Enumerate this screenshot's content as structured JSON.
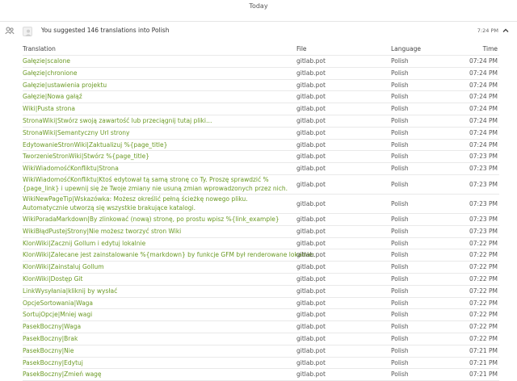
{
  "day_label": "Today",
  "activity": {
    "icon": "people-icon",
    "text": "You suggested 146 translations into Polish",
    "time": "7:24 PM",
    "collapse_icon": "chevron-up-icon"
  },
  "table": {
    "headers": {
      "translation": "Translation",
      "file": "File",
      "language": "Language",
      "time": "Time"
    },
    "rows": [
      {
        "translation": "Gałęzie|scalone",
        "file": "gitlab.pot",
        "language": "Polish",
        "time": "07:24 PM"
      },
      {
        "translation": "Gałęzie|chronione",
        "file": "gitlab.pot",
        "language": "Polish",
        "time": "07:24 PM"
      },
      {
        "translation": "Gałęzie|ustawienia projektu",
        "file": "gitlab.pot",
        "language": "Polish",
        "time": "07:24 PM"
      },
      {
        "translation": "Gałęzie|Nowa gałąź",
        "file": "gitlab.pot",
        "language": "Polish",
        "time": "07:24 PM"
      },
      {
        "translation": "Wiki|Pusta strona",
        "file": "gitlab.pot",
        "language": "Polish",
        "time": "07:24 PM"
      },
      {
        "translation": "StronaWiki|Stwórz swoją zawartość lub przeciągnij tutaj pliki…",
        "file": "gitlab.pot",
        "language": "Polish",
        "time": "07:24 PM"
      },
      {
        "translation": "StronaWiki|Semantyczny Url strony",
        "file": "gitlab.pot",
        "language": "Polish",
        "time": "07:24 PM"
      },
      {
        "translation": "EdytowanieStronWiki|Zaktualizuj %{page_title}",
        "file": "gitlab.pot",
        "language": "Polish",
        "time": "07:24 PM"
      },
      {
        "translation": "TworzenieStronWiki|Stwórz %{page_title}",
        "file": "gitlab.pot",
        "language": "Polish",
        "time": "07:23 PM"
      },
      {
        "translation": "WikiWiadomośćKonfliktu|Strona",
        "file": "gitlab.pot",
        "language": "Polish",
        "time": "07:23 PM"
      },
      {
        "translation": "WikiWiadomośćKonfliktu|Ktoś edytował tą samą stronę co Ty. Proszę sprawdzić %{page_link} i upewnij się że Twoje zmiany nie usuną zmian wprowadzonych przez nich.",
        "file": "gitlab.pot",
        "language": "Polish",
        "time": "07:23 PM",
        "tall": true
      },
      {
        "translation": "WikiNewPageTip|Wskazówka: Możesz określić pełną ścieżkę nowego pliku. Automatycznie utworzą się wszystkie brakujące katalogi.",
        "file": "gitlab.pot",
        "language": "Polish",
        "time": "07:23 PM",
        "tall": true
      },
      {
        "translation": "WikiPoradaMarkdown|By zlinkować (nową) stronę, po prostu wpisz %{link_example}",
        "file": "gitlab.pot",
        "language": "Polish",
        "time": "07:23 PM"
      },
      {
        "translation": "WikiBłądPustejStrony|Nie możesz tworzyć stron Wiki",
        "file": "gitlab.pot",
        "language": "Polish",
        "time": "07:23 PM"
      },
      {
        "translation": "KlonWiki|Zacznij Gollum i edytuj lokalnie",
        "file": "gitlab.pot",
        "language": "Polish",
        "time": "07:22 PM"
      },
      {
        "translation": "KlonWiki|Zalecane jest zainstalowanie %{markdown} by funkcje GFM był renderowane lokalnie:",
        "file": "gitlab.pot",
        "language": "Polish",
        "time": "07:22 PM"
      },
      {
        "translation": "KlonWiki|Zainstaluj Gollum",
        "file": "gitlab.pot",
        "language": "Polish",
        "time": "07:22 PM"
      },
      {
        "translation": "KlonWiki|Dostęp Git",
        "file": "gitlab.pot",
        "language": "Polish",
        "time": "07:22 PM"
      },
      {
        "translation": "LinkWysyłania|kliknij by wysłać",
        "file": "gitlab.pot",
        "language": "Polish",
        "time": "07:22 PM"
      },
      {
        "translation": "OpcjeSortowania|Waga",
        "file": "gitlab.pot",
        "language": "Polish",
        "time": "07:22 PM"
      },
      {
        "translation": "SortujOpcje|Mniej wagi",
        "file": "gitlab.pot",
        "language": "Polish",
        "time": "07:22 PM"
      },
      {
        "translation": "PasekBoczny|Waga",
        "file": "gitlab.pot",
        "language": "Polish",
        "time": "07:22 PM"
      },
      {
        "translation": "PasekBoczny|Brak",
        "file": "gitlab.pot",
        "language": "Polish",
        "time": "07:22 PM"
      },
      {
        "translation": "PasekBoczny|Nie",
        "file": "gitlab.pot",
        "language": "Polish",
        "time": "07:21 PM"
      },
      {
        "translation": "PasekBoczny|Edytuj",
        "file": "gitlab.pot",
        "language": "Polish",
        "time": "07:21 PM"
      },
      {
        "translation": "PasekBoczny|Zmień wagę",
        "file": "gitlab.pot",
        "language": "Polish",
        "time": "07:21 PM"
      }
    ]
  }
}
